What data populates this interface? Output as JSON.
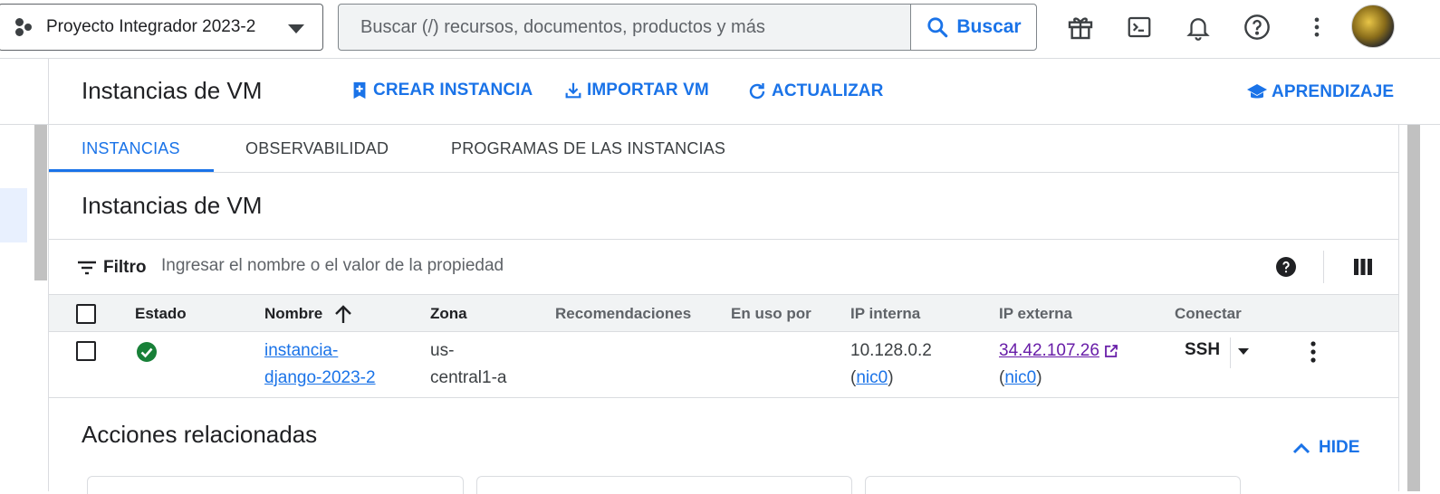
{
  "topbar": {
    "project_name": "Proyecto Integrador 2023-2",
    "search_placeholder": "Buscar (/) recursos, documentos, productos y más",
    "search_button": "Buscar",
    "icons": [
      "gift-icon",
      "cloud-shell-icon",
      "notifications-icon",
      "help-icon",
      "more-vert-icon"
    ]
  },
  "header": {
    "title": "Instancias de VM",
    "create_label": "CREAR INSTANCIA",
    "import_label": "IMPORTAR VM",
    "refresh_label": "ACTUALIZAR",
    "learn_label": "APRENDIZAJE"
  },
  "tabs": [
    {
      "label": "INSTANCIAS",
      "active": true
    },
    {
      "label": "OBSERVABILIDAD",
      "active": false
    },
    {
      "label": "PROGRAMAS DE LAS INSTANCIAS",
      "active": false
    }
  ],
  "section_title": "Instancias de VM",
  "filter": {
    "label": "Filtro",
    "placeholder": "Ingresar el nombre o el valor de la propiedad"
  },
  "table": {
    "columns": [
      "Estado",
      "Nombre",
      "Zona",
      "Recomendaciones",
      "En uso por",
      "IP interna",
      "IP externa",
      "Conectar"
    ],
    "rows": [
      {
        "status": "running",
        "name_line1": "instancia-",
        "name_line2": "django-2023-2",
        "zone_line1": "us-",
        "zone_line2": "central1-a",
        "internal_ip": "10.128.0.2",
        "internal_nic": "nic0",
        "external_ip": "34.42.107.26",
        "external_nic": "nic0",
        "connect": "SSH"
      }
    ]
  },
  "related": {
    "title": "Acciones relacionadas",
    "hide_label": "HIDE"
  },
  "colors": {
    "accent": "#1a73e8",
    "status_ok": "#188038",
    "visited_link": "#681da8"
  }
}
